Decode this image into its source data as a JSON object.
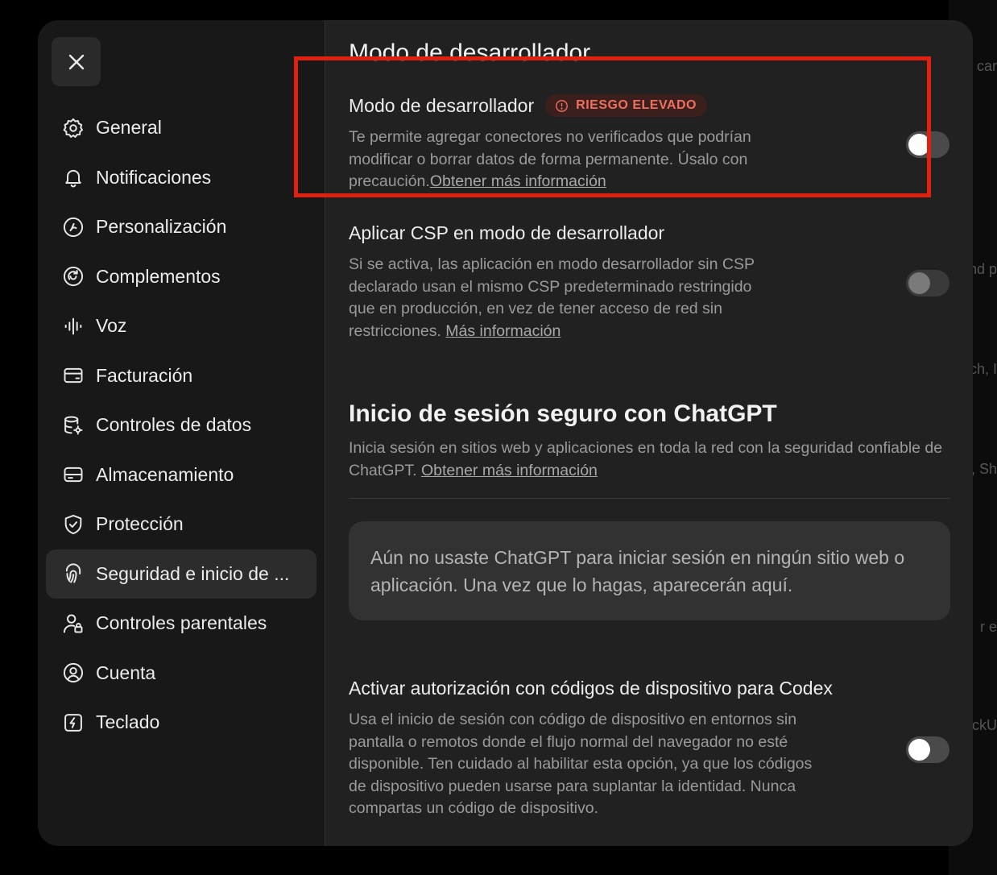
{
  "background_fragments": [
    "car",
    "nd p",
    "ch, I",
    ", Sh",
    "r e",
    "ckU"
  ],
  "close_button_label": "×",
  "sidebar": {
    "items": [
      {
        "label": "General",
        "icon": "gear-icon"
      },
      {
        "label": "Notificaciones",
        "icon": "bell-icon"
      },
      {
        "label": "Personalización",
        "icon": "personalization-icon"
      },
      {
        "label": "Complementos",
        "icon": "plugins-icon"
      },
      {
        "label": "Voz",
        "icon": "voice-waveform-icon"
      },
      {
        "label": "Facturación",
        "icon": "credit-card-icon"
      },
      {
        "label": "Controles de datos",
        "icon": "database-gear-icon"
      },
      {
        "label": "Almacenamiento",
        "icon": "storage-drive-icon"
      },
      {
        "label": "Protección",
        "icon": "shield-check-icon"
      },
      {
        "label": "Seguridad e inicio de ...",
        "icon": "fingerprint-icon",
        "active": true
      },
      {
        "label": "Controles parentales",
        "icon": "parental-user-lock-icon"
      },
      {
        "label": "Cuenta",
        "icon": "user-circle-icon"
      },
      {
        "label": "Teclado",
        "icon": "keyboard-bolt-icon"
      }
    ]
  },
  "main": {
    "title": "Modo de desarrollador",
    "developer_mode": {
      "title": "Modo de desarrollador",
      "badge": "RIESGO ELEVADO",
      "description": "Te permite agregar conectores no verificados que podrían modificar o borrar datos de forma permanente. Úsalo con precaución.",
      "link": "Obtener más información",
      "enabled": false
    },
    "csp": {
      "title": "Aplicar CSP en modo de desarrollador",
      "description": "Si se activa, las aplicación en modo desarrollador sin CSP declarado usan el mismo CSP predeterminado restringido que en producción, en vez de tener acceso de red sin restricciones.",
      "link": "Más información",
      "enabled": false,
      "disabled": true
    },
    "secure_login": {
      "title": "Inicio de sesión seguro con ChatGPT",
      "description": "Inicia sesión en sitios web y aplicaciones en toda la red con la seguridad confiable de ChatGPT.",
      "link": "Obtener más información",
      "empty_state": "Aún no usaste ChatGPT para iniciar sesión en ningún sitio web o aplicación. Una vez que lo hagas, aparecerán aquí."
    },
    "device_codes": {
      "title": "Activar autorización con códigos de dispositivo para Codex",
      "description": "Usa el inicio de sesión con código de dispositivo en entornos sin pantalla o remotos donde el flujo normal del navegador no esté disponible. Ten cuidado al habilitar esta opción, ya que los códigos de dispositivo pueden usarse para suplantar la identidad. Nunca compartas un código de dispositivo.",
      "enabled": false
    }
  },
  "colors": {
    "highlight": "#e0210f",
    "badge_text": "#f0705f",
    "badge_bg": "#3a1f1c"
  }
}
